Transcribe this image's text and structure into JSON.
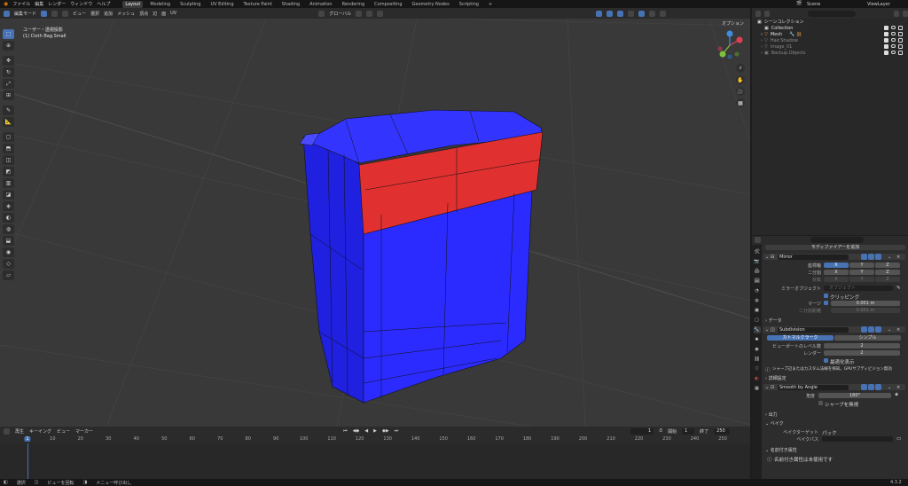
{
  "topbar": {
    "menus": [
      "ファイル",
      "編集",
      "レンダー",
      "ウィンドウ",
      "ヘルプ"
    ],
    "workspaces": [
      "Layout",
      "Modeling",
      "Sculpting",
      "UV Editing",
      "Texture Paint",
      "Shading",
      "Animation",
      "Rendering",
      "Compositing",
      "Geometry Nodes",
      "Scripting"
    ],
    "active_workspace": "Layout",
    "scene_label": "Scene",
    "viewlayer_label": "ViewLayer"
  },
  "viewport": {
    "mode_label": "編集モード",
    "menus": [
      "ビュー",
      "選択",
      "追加",
      "メッシュ",
      "頂点",
      "辺",
      "面",
      "UV"
    ],
    "transform_orientation": "グローバル",
    "options_label": "オプション",
    "view_name": "ユーザー・透視投影",
    "object_name": "(1) Cloth Bag.Small",
    "gizmo_axes": [
      "X",
      "Y",
      "Z"
    ]
  },
  "timeline": {
    "menus": [
      "再生",
      "キーイング",
      "ビュー",
      "マーカー"
    ],
    "current_frame": "1",
    "start_label": "開始",
    "start_value": "1",
    "end_label": "終了",
    "end_value": "250",
    "ticks": [
      "1",
      "10",
      "20",
      "30",
      "40",
      "50",
      "60",
      "70",
      "80",
      "90",
      "100",
      "110",
      "120",
      "130",
      "140",
      "150",
      "160",
      "170",
      "180",
      "190",
      "200",
      "210",
      "220",
      "230",
      "240",
      "250"
    ]
  },
  "statusbar": {
    "items": [
      "選択",
      "ビューを回転",
      "メニュー呼び出し"
    ],
    "version": "4.3.2"
  },
  "outliner": {
    "title": "シーンコレクション",
    "search_placeholder": "",
    "rows": [
      {
        "name": "Collection",
        "dim": false
      },
      {
        "name": "Mesh",
        "dim": false
      },
      {
        "name": "Hair.Shadow",
        "dim": true
      },
      {
        "name": "image_01",
        "dim": true
      },
      {
        "name": "Backup.Objects",
        "dim": true
      }
    ]
  },
  "properties": {
    "search_placeholder": "",
    "add_modifier": "モディファイアーを追加",
    "mirror": {
      "name": "Mirror",
      "axis_label": "座標軸",
      "bisect_label": "二分割",
      "flip_label": "反転",
      "axes": [
        "X",
        "Y",
        "Z"
      ],
      "mirror_object_label": "ミラーオブジェクト",
      "mirror_object_placeholder": "オブジェクト",
      "clipping_label": "クリッピング",
      "merge_label": "マージ",
      "merge_value": "0.001 m",
      "bisect_distance_label": "二分割距離",
      "bisect_distance_value": "0.001 m",
      "data_label": "データ"
    },
    "subdivision": {
      "name": "Subdivision",
      "tab_catmull": "カトマルクラーク",
      "tab_simple": "シンプル",
      "viewport_levels_label": "ビューポートのレベル数",
      "viewport_levels_value": "2",
      "render_label": "レンダー",
      "render_value": "2",
      "optimal_display_label": "最適化表示",
      "warning": "シャープ辺またはカスタム法線を探知。GPUサブディビジョン無効",
      "advanced_label": "詳細設定"
    },
    "smooth": {
      "name": "Smooth by Angle",
      "angle_label": "角度",
      "angle_value": "180°",
      "sharp_label": "シャープを無視",
      "output_label": "出力",
      "bake_label": "ベイク",
      "bake_target_label": "ベイクターゲット",
      "bake_target_value": "パック",
      "bake_path_label": "ベイクパス",
      "named_attr_label": "名前付き属性",
      "named_attr_info": "名前付き属性は未使用です"
    }
  },
  "colors": {
    "accent": "#4772b3",
    "mesh_blue": "#2b2bff",
    "mesh_red": "#e03030"
  }
}
